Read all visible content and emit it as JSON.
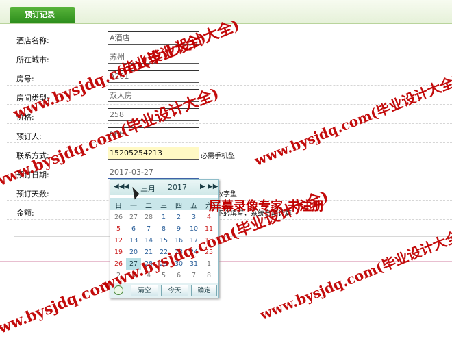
{
  "tab": {
    "label": "预订记录"
  },
  "form": {
    "rows": [
      {
        "label": "酒店名称:",
        "value": "A酒店"
      },
      {
        "label": "所在城市:",
        "value": "苏州"
      },
      {
        "label": "房号:",
        "value": "A201"
      },
      {
        "label": "房间类型:",
        "value": "双人房"
      },
      {
        "label": "价格:",
        "value": "258"
      },
      {
        "label": "预订人:",
        "value": "666"
      },
      {
        "label": "联系方式:",
        "value": "15205254213",
        "hint": "必需手机型"
      },
      {
        "label": "预订日期:",
        "value": "2017-03-27"
      },
      {
        "label": "预订天数:",
        "hint": "数字型"
      },
      {
        "label": "金额:",
        "hint": "不必填写，系统自动计算"
      }
    ]
  },
  "calendar": {
    "month": "三月",
    "year": "2017",
    "nav": {
      "prev_year": "◀◀",
      "prev_month": "◀",
      "next_month": "▶",
      "next_year": "▶▶"
    },
    "dows": [
      "日",
      "一",
      "二",
      "三",
      "四",
      "五",
      "六"
    ],
    "weeks": [
      [
        "26",
        "27",
        "28",
        "1",
        "2",
        "3",
        "4"
      ],
      [
        "5",
        "6",
        "7",
        "8",
        "9",
        "10",
        "11"
      ],
      [
        "12",
        "13",
        "14",
        "15",
        "16",
        "17",
        "18"
      ],
      [
        "19",
        "20",
        "21",
        "22",
        "23",
        "24",
        "25"
      ],
      [
        "26",
        "27",
        "28",
        "29",
        "30",
        "31",
        "1"
      ],
      [
        "2",
        "3",
        "4",
        "5",
        "6",
        "7",
        "8"
      ]
    ],
    "selected": "27",
    "buttons": {
      "clear": "清空",
      "today": "今天",
      "ok": "确定"
    }
  },
  "watermark": {
    "url": "www.bysjdq.com",
    "brand": "(毕业设计大全)",
    "recorder": "屏幕录像专家  未注册"
  }
}
